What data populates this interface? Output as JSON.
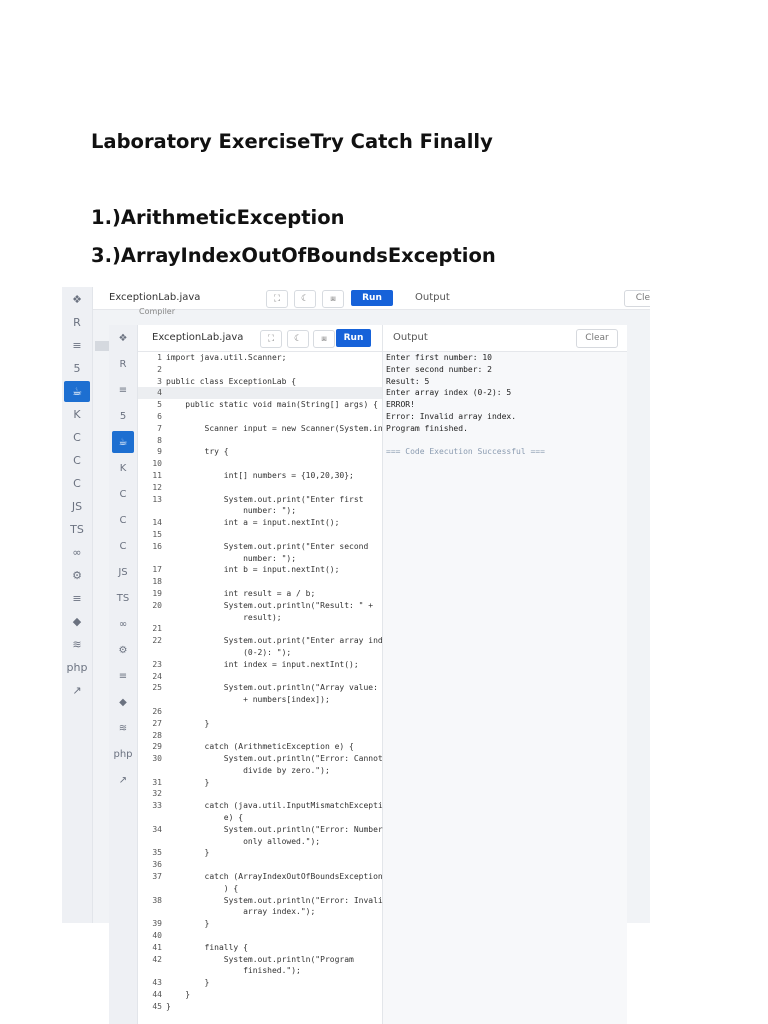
{
  "document": {
    "title": "Laboratory ExerciseTry Catch Finally",
    "headings": [
      "1.)ArithmeticException",
      "3.)ArrayIndexOutOfBoundsException"
    ]
  },
  "screenshot_back": {
    "file_tab": "ExceptionLab.java",
    "run_label": "Run",
    "output_label": "Output",
    "clear_label": "Clear",
    "compiler_label": "Compiler"
  },
  "screenshot_front": {
    "file_tab": "ExceptionLab.java",
    "run_label": "Run",
    "output_label": "Output",
    "clear_label": "Clear",
    "language_icons": [
      "python-icon",
      "r-icon",
      "sql-icon",
      "html-icon",
      "java-icon",
      "kotlin-icon",
      "c-icon",
      "cpp-icon",
      "csharp-icon",
      "js-icon",
      "ts-icon",
      "go-icon",
      "php-icon",
      "swift-icon",
      "rust-icon"
    ],
    "code": [
      {
        "n": "1",
        "t": "import java.util.Scanner;"
      },
      {
        "n": "2",
        "t": ""
      },
      {
        "n": "3",
        "t": "public class ExceptionLab {"
      },
      {
        "n": "4",
        "t": ""
      },
      {
        "n": "5",
        "t": "    public static void main(String[] args) {"
      },
      {
        "n": "6",
        "t": ""
      },
      {
        "n": "7",
        "t": "        Scanner input = new Scanner(System.in);"
      },
      {
        "n": "8",
        "t": ""
      },
      {
        "n": "9",
        "t": "        try {"
      },
      {
        "n": "10",
        "t": ""
      },
      {
        "n": "11",
        "t": "            int[] numbers = {10,20,30};"
      },
      {
        "n": "12",
        "t": ""
      },
      {
        "n": "13",
        "t": "            System.out.print(\"Enter first"
      },
      {
        "n": "",
        "t": "                number: \");"
      },
      {
        "n": "14",
        "t": "            int a = input.nextInt();"
      },
      {
        "n": "15",
        "t": ""
      },
      {
        "n": "16",
        "t": "            System.out.print(\"Enter second"
      },
      {
        "n": "",
        "t": "                number: \");"
      },
      {
        "n": "17",
        "t": "            int b = input.nextInt();"
      },
      {
        "n": "18",
        "t": ""
      },
      {
        "n": "19",
        "t": "            int result = a / b;"
      },
      {
        "n": "20",
        "t": "            System.out.println(\"Result: \" +"
      },
      {
        "n": "",
        "t": "                result);"
      },
      {
        "n": "21",
        "t": ""
      },
      {
        "n": "22",
        "t": "            System.out.print(\"Enter array index"
      },
      {
        "n": "",
        "t": "                (0-2): \");"
      },
      {
        "n": "23",
        "t": "            int index = input.nextInt();"
      },
      {
        "n": "24",
        "t": ""
      },
      {
        "n": "25",
        "t": "            System.out.println(\"Array value: \""
      },
      {
        "n": "",
        "t": "                + numbers[index]);"
      },
      {
        "n": "26",
        "t": ""
      },
      {
        "n": "27",
        "t": "        }"
      },
      {
        "n": "28",
        "t": ""
      },
      {
        "n": "29",
        "t": "        catch (ArithmeticException e) {"
      },
      {
        "n": "30",
        "t": "            System.out.println(\"Error: Cannot"
      },
      {
        "n": "",
        "t": "                divide by zero.\");"
      },
      {
        "n": "31",
        "t": "        }"
      },
      {
        "n": "32",
        "t": ""
      },
      {
        "n": "33",
        "t": "        catch (java.util.InputMismatchException"
      },
      {
        "n": "",
        "t": "            e) {"
      },
      {
        "n": "34",
        "t": "            System.out.println(\"Error: Numbers"
      },
      {
        "n": "",
        "t": "                only allowed.\");"
      },
      {
        "n": "35",
        "t": "        }"
      },
      {
        "n": "36",
        "t": ""
      },
      {
        "n": "37",
        "t": "        catch (ArrayIndexOutOfBoundsException e"
      },
      {
        "n": "",
        "t": "            ) {"
      },
      {
        "n": "38",
        "t": "            System.out.println(\"Error: Invalid"
      },
      {
        "n": "",
        "t": "                array index.\");"
      },
      {
        "n": "39",
        "t": "        }"
      },
      {
        "n": "40",
        "t": ""
      },
      {
        "n": "41",
        "t": "        finally {"
      },
      {
        "n": "42",
        "t": "            System.out.println(\"Program"
      },
      {
        "n": "",
        "t": "                finished.\");"
      },
      {
        "n": "43",
        "t": "        }"
      },
      {
        "n": "44",
        "t": "    }"
      },
      {
        "n": "45",
        "t": "}"
      }
    ],
    "output": [
      "Enter first number: 10",
      "Enter second number: 2",
      "Result: 5",
      "Enter array index (0-2): 5",
      "ERROR!",
      "Error: Invalid array index.",
      "Program finished.",
      "",
      "=== Code Execution Successful ==="
    ]
  }
}
